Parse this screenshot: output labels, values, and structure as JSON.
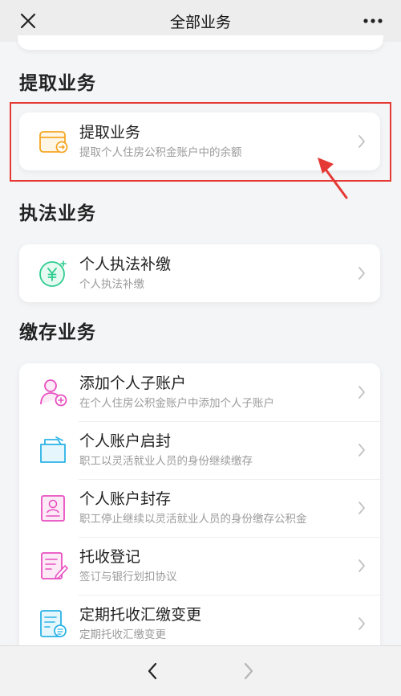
{
  "header": {
    "title": "全部业务",
    "close_icon": "close-icon",
    "more_icon": "more-icon"
  },
  "sections": [
    {
      "title": "提取业务",
      "items": [
        {
          "name": "提取业务",
          "desc": "提取个人住房公积金账户中的余额",
          "icon": "withdraw-card-icon"
        }
      ]
    },
    {
      "title": "执法业务",
      "items": [
        {
          "name": "个人执法补缴",
          "desc": "个人执法补缴",
          "icon": "yen-coin-icon"
        }
      ]
    },
    {
      "title": "缴存业务",
      "items": [
        {
          "name": "添加个人子账户",
          "desc": "在个人住房公积金账户中添加个人子账户",
          "icon": "add-user-icon"
        },
        {
          "name": "个人账户启封",
          "desc": "职工以灵活就业人员的身份继续缴存",
          "icon": "open-folder-icon"
        },
        {
          "name": "个人账户封存",
          "desc": "职工停止继续以灵活就业人员的身份缴存公积金",
          "icon": "sealed-id-icon"
        },
        {
          "name": "托收登记",
          "desc": "签订与银行划扣协议",
          "icon": "document-edit-icon"
        },
        {
          "name": "定期托收汇缴变更",
          "desc": "定期托收汇缴变更",
          "icon": "document-list-icon"
        }
      ]
    }
  ],
  "colors": {
    "highlight": "#e53935",
    "withdraw_icon": "#f5a623",
    "yen_icon": "#2ecc8f",
    "deposit_icon": "#e84fc0",
    "folder_icon": "#2bb3e6",
    "list_icon": "#2bb3e6"
  },
  "footer": {
    "back_icon": "back-arrow-icon",
    "forward_icon": "forward-arrow-icon"
  }
}
